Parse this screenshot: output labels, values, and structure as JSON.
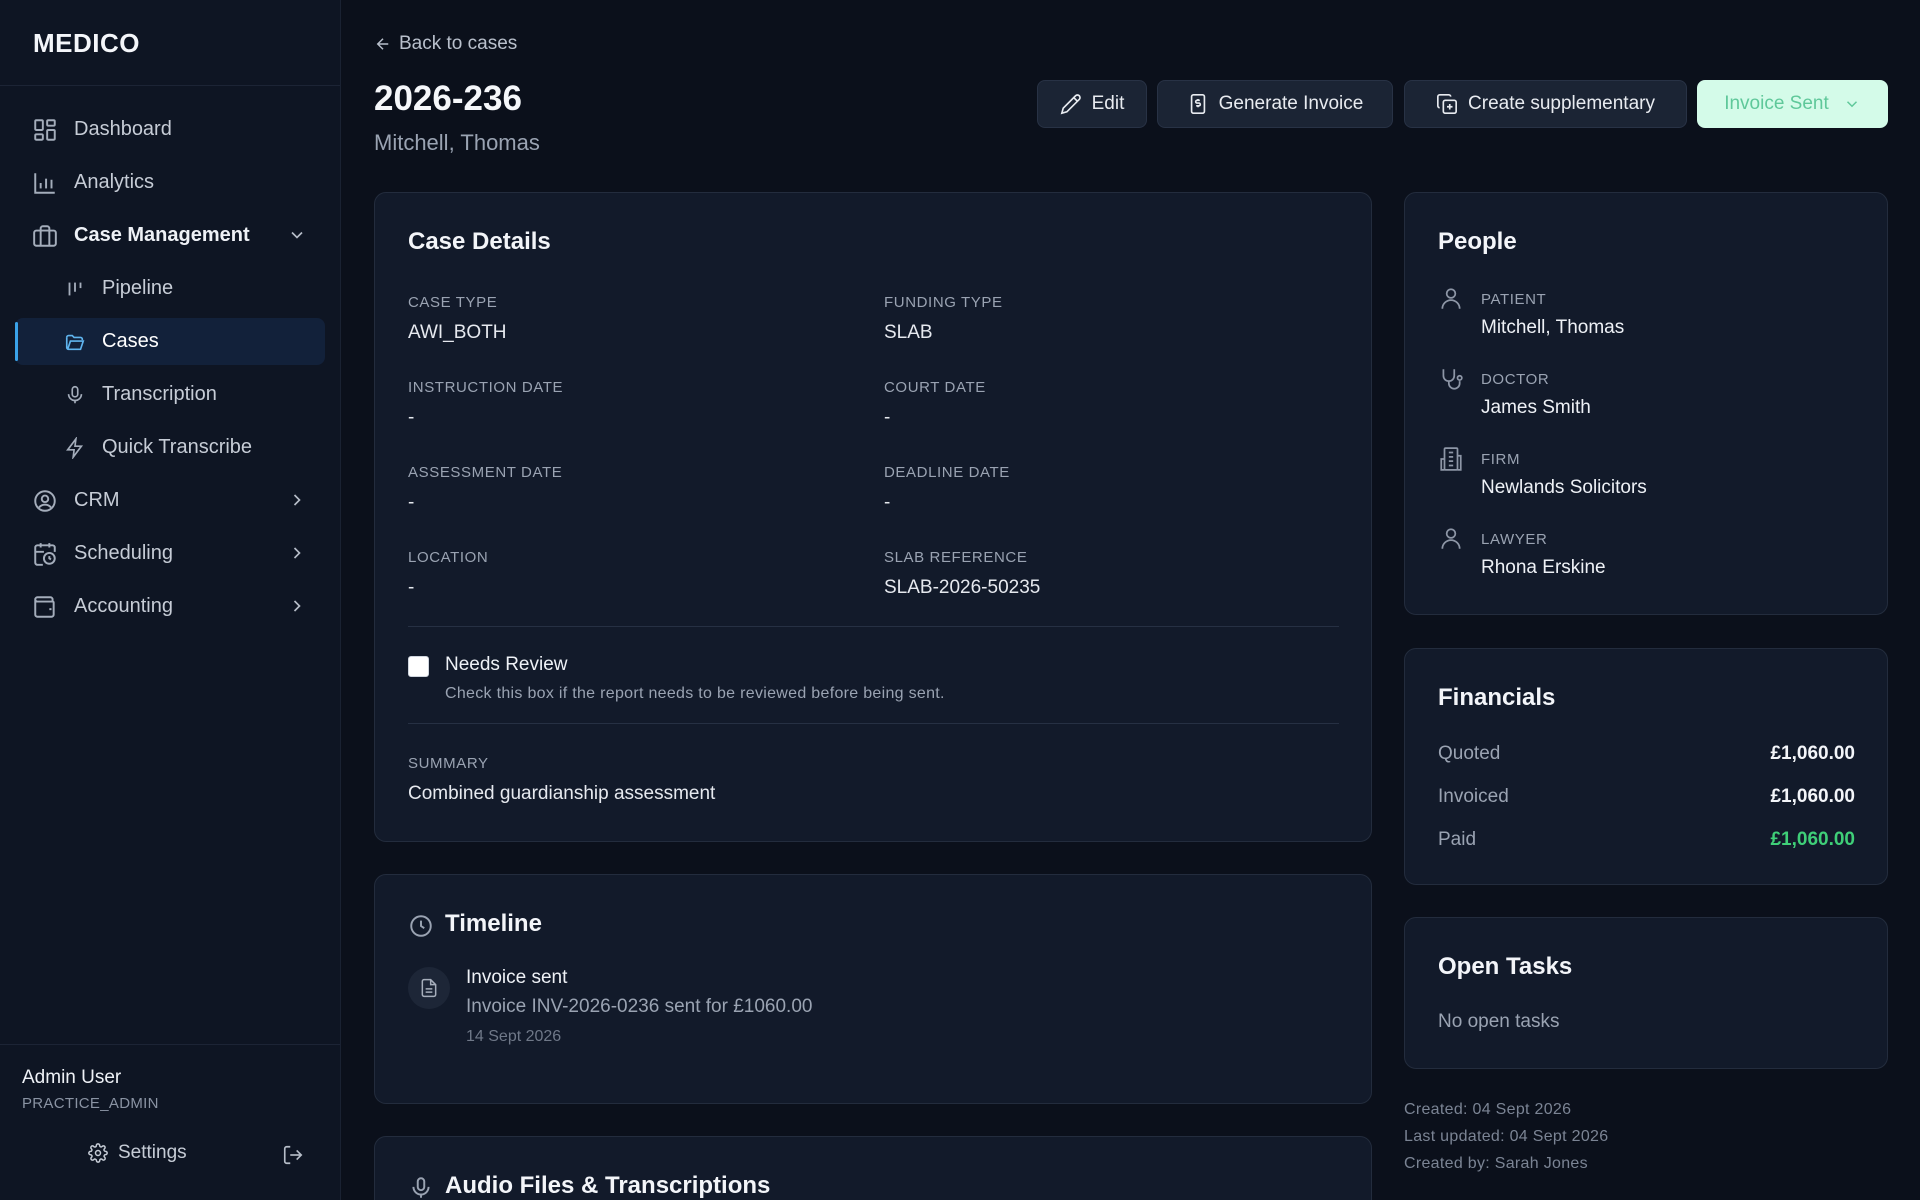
{
  "app": {
    "brand": "MEDICO"
  },
  "sidebar": {
    "items": [
      {
        "label": "Dashboard",
        "icon": "dashboard-icon"
      },
      {
        "label": "Analytics",
        "icon": "bar-chart-icon"
      },
      {
        "label": "Case Management",
        "icon": "briefcase-icon",
        "expanded": true
      },
      {
        "label": "Pipeline",
        "icon": "pipeline-icon"
      },
      {
        "label": "Cases",
        "icon": "folder-open-icon",
        "active": true
      },
      {
        "label": "Transcription",
        "icon": "microphone-icon"
      },
      {
        "label": "Quick Transcribe",
        "icon": "lightning-icon"
      },
      {
        "label": "CRM",
        "icon": "user-circle-icon"
      },
      {
        "label": "Scheduling",
        "icon": "calendar-clock-icon"
      },
      {
        "label": "Accounting",
        "icon": "wallet-icon"
      }
    ],
    "user": {
      "name": "Admin User",
      "role": "PRACTICE_ADMIN"
    },
    "settings_label": "Settings"
  },
  "header": {
    "back_label": "Back to cases",
    "title": "2026-236",
    "subtitle": "Mitchell, Thomas",
    "actions": {
      "edit": "Edit",
      "generate_invoice": "Generate Invoice",
      "create_supplementary": "Create supplementary",
      "status": "Invoice Sent"
    }
  },
  "case_details": {
    "title": "Case Details",
    "fields": [
      {
        "label": "Case Type",
        "value": "AWI_BOTH"
      },
      {
        "label": "Funding Type",
        "value": "SLAB"
      },
      {
        "label": "Instruction Date",
        "value": "-"
      },
      {
        "label": "Court Date",
        "value": "-"
      },
      {
        "label": "Assessment Date",
        "value": "-"
      },
      {
        "label": "Deadline Date",
        "value": "-"
      },
      {
        "label": "Location",
        "value": "-"
      },
      {
        "label": "SLAB Reference",
        "value": "SLAB-2026-50235"
      }
    ],
    "needs_review": {
      "label": "Needs Review",
      "help": "Check this box if the report needs to be reviewed before being sent.",
      "checked": false
    },
    "summary": {
      "label": "Summary",
      "value": "Combined guardianship assessment"
    }
  },
  "timeline": {
    "title": "Timeline",
    "events": [
      {
        "title": "Invoice sent",
        "description": "Invoice INV-2026-0236 sent for £1060.00",
        "date": "14 Sept 2026"
      }
    ]
  },
  "audio": {
    "title": "Audio Files & Transcriptions"
  },
  "people": {
    "title": "People",
    "entries": [
      {
        "role": "Patient",
        "name": "Mitchell, Thomas",
        "icon": "user-icon"
      },
      {
        "role": "Doctor",
        "name": "James Smith",
        "icon": "stethoscope-icon"
      },
      {
        "role": "Firm",
        "name": "Newlands Solicitors",
        "icon": "building-icon"
      },
      {
        "role": "Lawyer",
        "name": "Rhona Erskine",
        "icon": "user-icon"
      }
    ]
  },
  "financials": {
    "title": "Financials",
    "rows": [
      {
        "label": "Quoted",
        "value": "£1,060.00"
      },
      {
        "label": "Invoiced",
        "value": "£1,060.00"
      },
      {
        "label": "Paid",
        "value": "£1,060.00"
      }
    ],
    "colors": {
      "paid": "#3fcf78"
    }
  },
  "tasks": {
    "title": "Open Tasks",
    "empty": "No open tasks"
  },
  "meta": {
    "created": "Created: 04 Sept 2026",
    "updated": "Last updated: 04 Sept 2026",
    "created_by": "Created by: Sarah Jones"
  },
  "colors": {
    "accent": "#3aa2e8",
    "status_bg": "#d4fbe9",
    "status_text": "#5fc89a"
  }
}
